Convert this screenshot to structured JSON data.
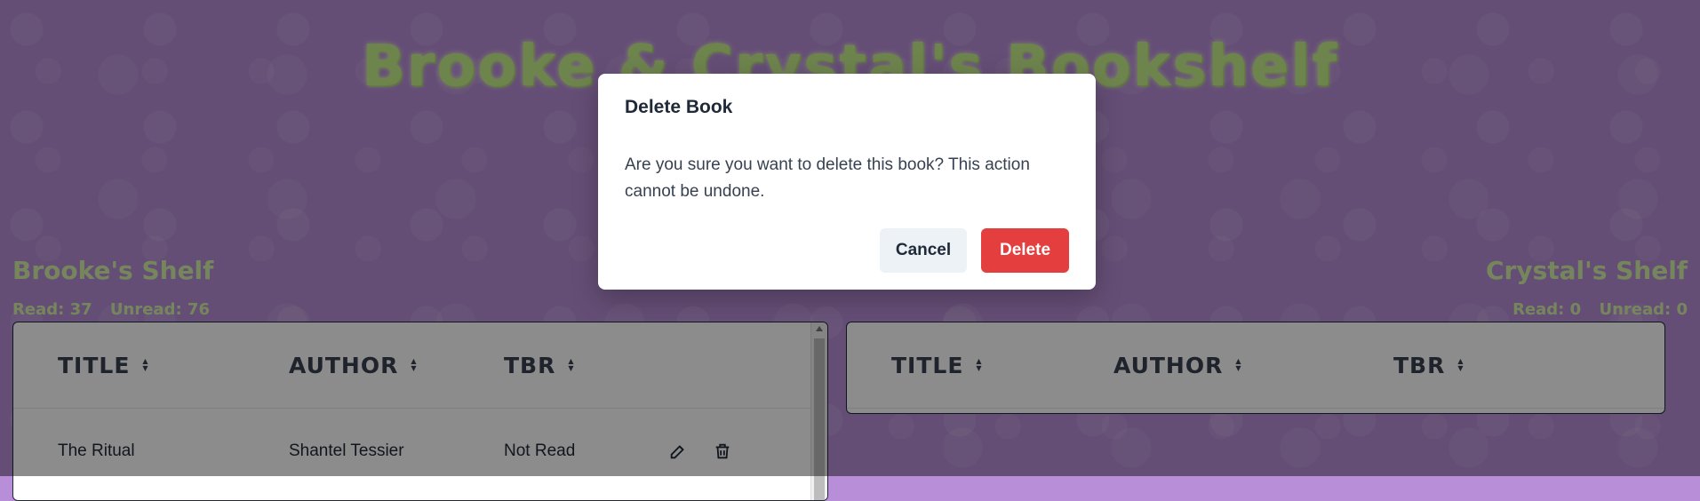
{
  "app": {
    "title": "Brooke & Crystal's Bookshelf"
  },
  "shelves": {
    "left": {
      "title": "Brooke's Shelf",
      "read_label": "Read: 37",
      "unread_label": "Unread: 76",
      "columns": [
        "TITLE",
        "AUTHOR",
        "TBR"
      ],
      "rows": [
        {
          "title": "The Ritual",
          "author": "Shantel Tessier",
          "tbr": "Not Read"
        }
      ]
    },
    "right": {
      "title": "Crystal's Shelf",
      "read_label": "Read: 0",
      "unread_label": "Unread: 0",
      "columns": [
        "TITLE",
        "AUTHOR",
        "TBR"
      ]
    }
  },
  "modal": {
    "title": "Delete Book",
    "body": "Are you sure you want to delete this book? This action cannot be undone.",
    "cancel_label": "Cancel",
    "delete_label": "Delete"
  },
  "icons": {
    "sort": "sort-icon",
    "edit": "edit-icon",
    "delete": "trash-icon"
  },
  "colors": {
    "background": "#b98ed8",
    "title_green": "#c9f08c",
    "delete_red": "#e53e3e",
    "cancel_gray": "#edf2f7"
  }
}
